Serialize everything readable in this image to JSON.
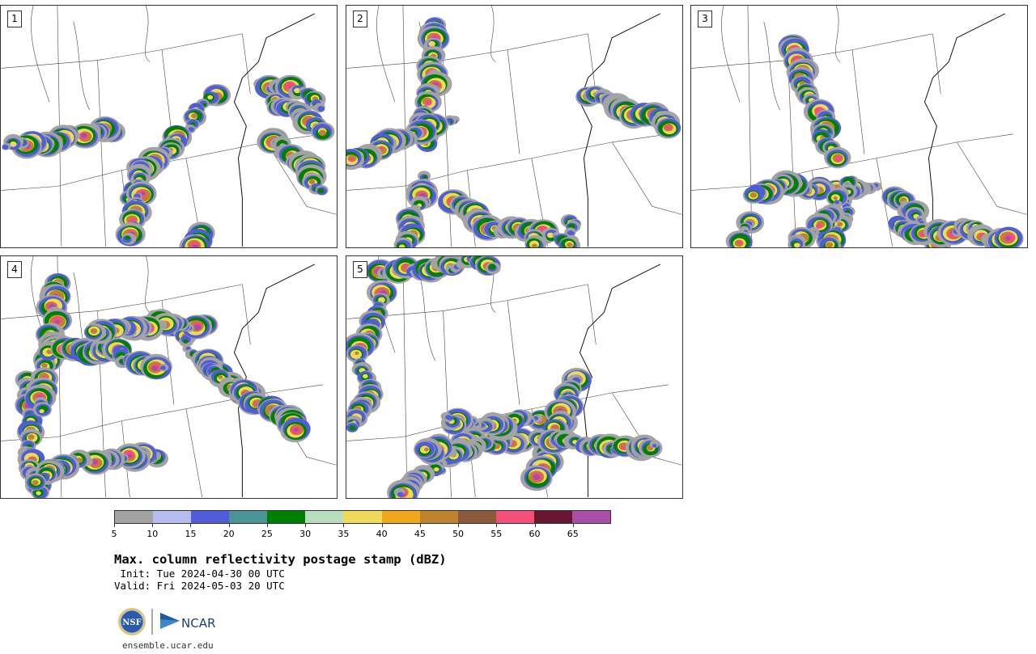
{
  "panels": [
    {
      "label": "1",
      "seed": 11
    },
    {
      "label": "2",
      "seed": 27
    },
    {
      "label": "3",
      "seed": 43
    },
    {
      "label": "4",
      "seed": 59
    },
    {
      "label": "5",
      "seed": 71
    }
  ],
  "colorbar": {
    "colors": [
      "#a3a3a3",
      "#b5bdee",
      "#4f5ed8",
      "#4a9496",
      "#008000",
      "#b9dcbd",
      "#f0d95a",
      "#f0a91c",
      "#bf8330",
      "#8a5a3a",
      "#f44f78",
      "#681632",
      "#a84ea8"
    ],
    "ticks": [
      "5",
      "10",
      "15",
      "20",
      "25",
      "30",
      "35",
      "40",
      "45",
      "50",
      "55",
      "60",
      "65"
    ]
  },
  "title": "Max. column reflectivity postage stamp (dBZ)",
  "init": " Init: Tue 2024-04-30 00 UTC",
  "valid": "Valid: Fri 2024-05-03 20 UTC",
  "logos": {
    "nsf": "NSF",
    "ncar": "NCAR"
  },
  "site": "ensemble.ucar.edu"
}
